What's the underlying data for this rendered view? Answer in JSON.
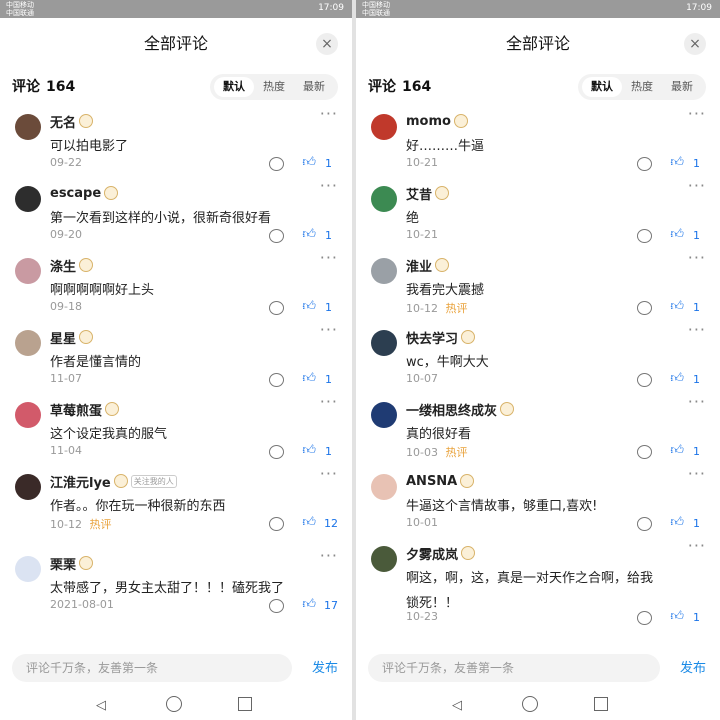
{
  "status": {
    "carrier1": "中国移动",
    "carrier2": "中国联通",
    "time": "17:09"
  },
  "header": {
    "title": "全部评论",
    "close": "×"
  },
  "count_label": "评论",
  "count": "164",
  "sort_tabs": [
    "默认",
    "热度",
    "最新"
  ],
  "left_comments": [
    {
      "name": "无名",
      "text": "可以拍电影了",
      "date": "09-22",
      "hot": "",
      "likes": "1",
      "avatar_color": "#6b4b3a"
    },
    {
      "name": "escape",
      "text": "第一次看到这样的小说，很新奇很好看",
      "date": "09-20",
      "hot": "",
      "likes": "1",
      "avatar_color": "#2d2d2d"
    },
    {
      "name": "涤生",
      "text": "啊啊啊啊啊好上头",
      "date": "09-18",
      "hot": "",
      "likes": "1",
      "avatar_color": "#c99aa2"
    },
    {
      "name": "星星",
      "text": "作者是懂言情的",
      "date": "11-07",
      "hot": "",
      "likes": "1",
      "avatar_color": "#b9a28f"
    },
    {
      "name": "草莓煎蛋",
      "text": "这个设定我真的服气",
      "date": "11-04",
      "hot": "",
      "likes": "1",
      "avatar_color": "#d25a6a"
    },
    {
      "name": "江淮元lye",
      "tag": "关注我的人",
      "text": "作者。。你在玩一种很新的东西",
      "date": "10-12",
      "hot": "热评",
      "likes": "12",
      "avatar_color": "#3a2a28"
    },
    {
      "name": "栗栗",
      "text": "太带感了，男女主太甜了！！！磕死我了",
      "date": "2021-08-01",
      "hot": "",
      "likes": "17",
      "avatar_color": "#dbe3f2"
    }
  ],
  "right_comments": [
    {
      "name": "momo",
      "text": "好………牛逼",
      "date": "10-21",
      "hot": "",
      "likes": "1",
      "avatar_color": "#c0392b"
    },
    {
      "name": "艾昔",
      "text": "绝",
      "date": "10-21",
      "hot": "",
      "likes": "1",
      "avatar_color": "#3c8a52"
    },
    {
      "name": "淮业",
      "text": "我看完大震撼",
      "date": "10-12",
      "hot": "热评",
      "likes": "1",
      "avatar_color": "#9aa0a6"
    },
    {
      "name": "快去学习",
      "text": "wc，牛啊大大",
      "date": "10-07",
      "hot": "",
      "likes": "1",
      "avatar_color": "#2c3e50"
    },
    {
      "name": "一缕相思终成灰",
      "text": "真的很好看",
      "date": "10-03",
      "hot": "热评",
      "likes": "1",
      "avatar_color": "#1f3b73"
    },
    {
      "name": "ANSNA",
      "text": "牛逼这个言情故事，够重口,喜欢!",
      "date": "10-01",
      "hot": "",
      "likes": "1",
      "avatar_color": "#e8c2b4"
    },
    {
      "name": "夕雾成岚",
      "text": "啊这，啊，这，真是一对天作之合啊，给我",
      "text2": "锁死！！",
      "date": "10-23",
      "hot": "",
      "likes": "1",
      "avatar_color": "#4a5a3a"
    }
  ],
  "input": {
    "placeholder": "评论千万条，友善第一条",
    "publish": "发布"
  }
}
